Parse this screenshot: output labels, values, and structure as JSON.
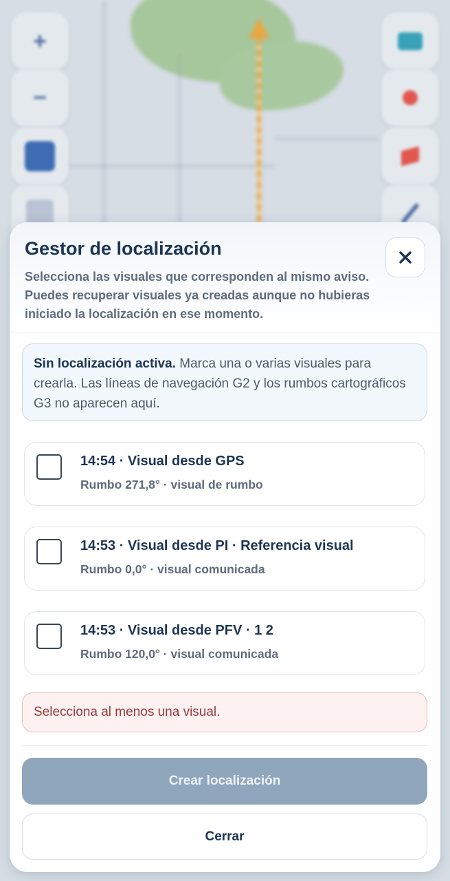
{
  "dialog": {
    "title": "Gestor de localización",
    "description": "Selecciona las visuales que corresponden al mismo aviso. Puedes recuperar visuales ya creadas aunque no hubieras iniciado la localización en ese momento.",
    "close_icon": "close-icon"
  },
  "notice": {
    "strong": "Sin localización activa.",
    "text": " Marca una o varias visuales para crearla. Las líneas de navegación G2 y los rumbos cartográficos G3 no aparecen aquí."
  },
  "visuals": [
    {
      "title": "14:54 · Visual desde GPS",
      "subtitle": "Rumbo 271,8° · visual de rumbo",
      "checked": false
    },
    {
      "title": "14:53 · Visual desde PI · Referencia visual",
      "subtitle": "Rumbo 0,0° · visual comunicada",
      "checked": false
    },
    {
      "title": "14:53 · Visual desde PFV · 1 2",
      "subtitle": "Rumbo 120,0° · visual comunicada",
      "checked": false
    }
  ],
  "error": "Selecciona al menos una visual.",
  "actions": {
    "create_label": "Crear localización",
    "close_label": "Cerrar"
  },
  "colors": {
    "title": "#1d3554",
    "primary_disabled": "#8fa6bd",
    "error_text": "#9b3a3a"
  },
  "map_controls": {
    "left": [
      "zoom-in-icon",
      "zoom-out-icon",
      "layers-icon",
      "legend-icon"
    ],
    "right": [
      "card-icon",
      "pin-icon",
      "flag-icon",
      "pen-icon"
    ]
  }
}
